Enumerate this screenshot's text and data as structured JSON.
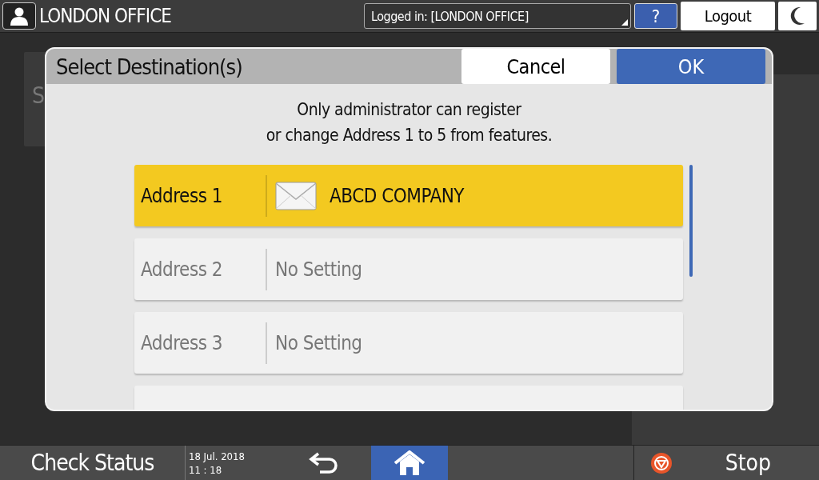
{
  "header": {
    "title": "LONDON OFFICE",
    "login": "Logged in: [LONDON OFFICE]",
    "help": "?",
    "logout": "Logout"
  },
  "background": {
    "card_letter": "S"
  },
  "dialog": {
    "title": "Select Destination(s)",
    "cancel": "Cancel",
    "ok": "OK",
    "message": [
      "Only administrator can register",
      "or change Address 1 to 5 from features."
    ],
    "rows": [
      {
        "label": "Address 1",
        "value": "ABCD COMPANY",
        "selected": true,
        "kind": "email"
      },
      {
        "label": "Address 2",
        "value": "No Setting",
        "selected": false,
        "kind": "empty"
      },
      {
        "label": "Address 3",
        "value": "No Setting",
        "selected": false,
        "kind": "empty"
      }
    ]
  },
  "bottom_bar": {
    "check_status": "Check Status",
    "date": "18 Jul. 2018",
    "time": "11 : 18",
    "stop": "Stop"
  }
}
